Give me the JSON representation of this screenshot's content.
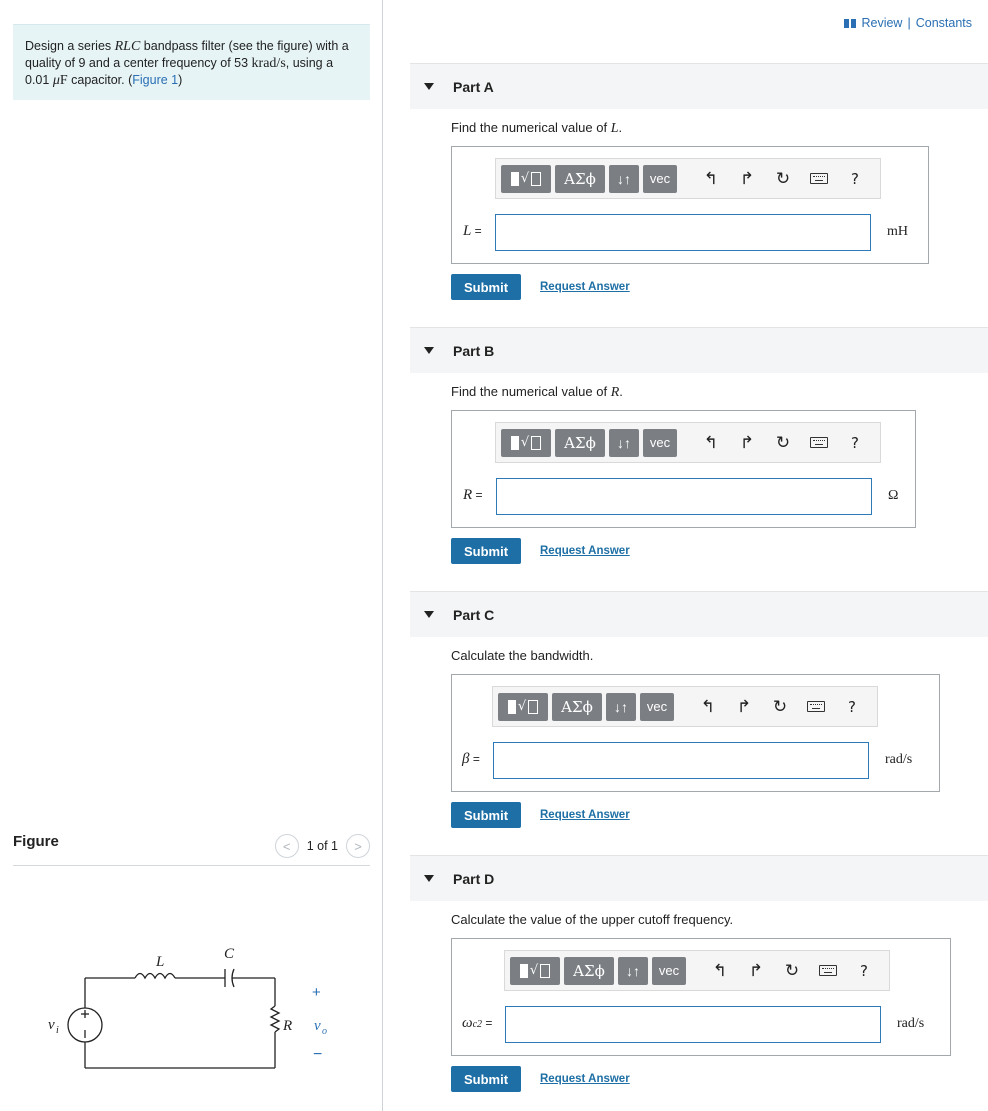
{
  "problem": {
    "text_1": "Design a series ",
    "rlc": "RLC",
    "text_2": " bandpass filter (see the figure) with a quality of 9 and a center frequency of 53 ",
    "freq_unit": "krad/s",
    "text_3": ", using a 0.01 ",
    "mu": "μ",
    "farad": "F",
    "text_4": " capacitor. (",
    "figure_link": "Figure 1",
    "text_5": ")"
  },
  "figure": {
    "title": "Figure",
    "pager_text": "1 of 1",
    "prev_glyph": "<",
    "next_glyph": ">",
    "labels": {
      "L": "L",
      "C": "C",
      "R": "R",
      "vi": "v",
      "vi_sub": "i",
      "vo": "v",
      "vo_sub": "o",
      "plus": "+",
      "minus": "−"
    }
  },
  "header": {
    "review": "Review",
    "separator": " | ",
    "constants": "Constants"
  },
  "toolbar": {
    "greek": "ΑΣϕ",
    "arrows": "↓↑",
    "vec": "vec",
    "undo": "↰",
    "redo": "↱",
    "reset": "↻",
    "help": "?"
  },
  "buttons": {
    "submit": "Submit",
    "request": "Request Answer"
  },
  "parts": [
    {
      "title": "Part A",
      "prompt_pre": "Find the numerical value of ",
      "prompt_var": "L",
      "prompt_post": ".",
      "var": "L",
      "var_sub": "",
      "equals": " =",
      "input_value": "",
      "unit": "mH"
    },
    {
      "title": "Part B",
      "prompt_pre": "Find the numerical value of ",
      "prompt_var": "R",
      "prompt_post": ".",
      "var": "R",
      "var_sub": "",
      "equals": " =",
      "input_value": "",
      "unit": "Ω"
    },
    {
      "title": "Part C",
      "prompt_pre": "Calculate the bandwidth.",
      "prompt_var": "",
      "prompt_post": "",
      "var": "β",
      "var_sub": "",
      "equals": " =",
      "input_value": "",
      "unit": "rad/s"
    },
    {
      "title": "Part D",
      "prompt_pre": "Calculate the value of the upper cutoff frequency.",
      "prompt_var": "",
      "prompt_post": "",
      "var": "ω",
      "var_sub": "c2",
      "equals": " =",
      "input_value": "",
      "unit": "rad/s"
    }
  ]
}
